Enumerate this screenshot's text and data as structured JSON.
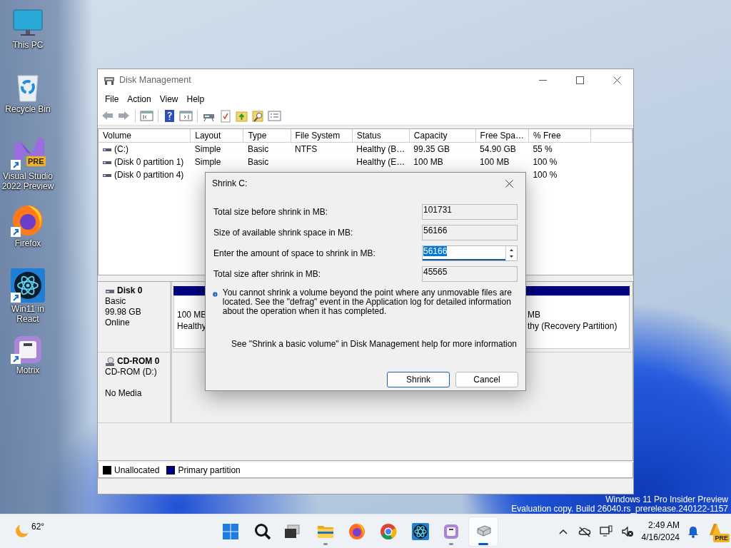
{
  "desktop_icons": [
    {
      "label": "This PC",
      "kind": "monitor",
      "shortcut": false
    },
    {
      "label": "Recycle Bin",
      "kind": "recycle",
      "shortcut": false
    },
    {
      "label": "Visual Studio 2022 Preview",
      "kind": "vs",
      "shortcut": true,
      "badge": "PRE"
    },
    {
      "label": "Firefox",
      "kind": "firefox",
      "shortcut": true
    },
    {
      "label": "Win11 in React",
      "kind": "react",
      "shortcut": true
    },
    {
      "label": "Motrix",
      "kind": "motrix",
      "shortcut": true
    }
  ],
  "window": {
    "title": "Disk Management",
    "menu": [
      "File",
      "Action",
      "View",
      "Help"
    ],
    "table": {
      "columns": [
        "Volume",
        "Layout",
        "Type",
        "File System",
        "Status",
        "Capacity",
        "Free Spa…",
        "% Free"
      ],
      "rows": [
        {
          "volume": "(C:)",
          "layout": "Simple",
          "type": "Basic",
          "file_system": "NTFS",
          "status": "Healthy (B…",
          "capacity": "99.35 GB",
          "free_space": "54.90 GB",
          "percent_free": "55 %"
        },
        {
          "volume": "(Disk 0 partition 1)",
          "layout": "Simple",
          "type": "Basic",
          "status": "Healthy (E…",
          "capacity": "100 MB",
          "free_space": "100 MB",
          "percent_free": "100 %"
        },
        {
          "volume": "(Disk 0 partition 4)",
          "percent_free": "100 %"
        }
      ]
    },
    "disks": [
      {
        "name": "Disk 0",
        "kind": "disk",
        "lines": [
          "Basic",
          "99.98 GB",
          "Online"
        ],
        "partitions": [
          {
            "lines": [
              "100 MB",
              "Healthy"
            ]
          },
          {
            "lines": [
              "MB",
              "thy (Recovery Partition)"
            ]
          }
        ]
      },
      {
        "name": "CD-ROM 0",
        "kind": "cdrom",
        "lines": [
          "CD-ROM (D:)",
          "No Media"
        ]
      }
    ],
    "legend": [
      {
        "label": "Unallocated",
        "color": "#000000"
      },
      {
        "label": "Primary partition",
        "color": "#000080"
      }
    ]
  },
  "dialog": {
    "title": "Shrink C:",
    "fields": [
      {
        "label": "Total size before shrink in MB:",
        "value": "101731",
        "kind": "readonly"
      },
      {
        "label": "Size of available shrink space in MB:",
        "value": "56166",
        "kind": "readonly"
      },
      {
        "label": "Enter the amount of space to shrink in MB:",
        "value": "56166",
        "kind": "spin",
        "text_selected": true
      },
      {
        "label": "Total size after shrink in MB:",
        "value": "45565",
        "kind": "readonly"
      }
    ],
    "info": "You cannot shrink a volume beyond the point where any unmovable files are located. See the \"defrag\" event in the Application log for detailed information about the operation when it has completed.",
    "help": "See \"Shrink a basic volume\" in Disk Management help for more information",
    "buttons": [
      {
        "label": "Shrink",
        "default": true
      },
      {
        "label": "Cancel",
        "default": false
      }
    ]
  },
  "watermark": [
    "Windows 11 Pro Insider Preview",
    "Evaluation copy. Build 26040.rs_prerelease.240122-1157"
  ],
  "taskbar": {
    "weather": "62°",
    "apps": [
      {
        "kind": "start",
        "running": false,
        "selected": false
      },
      {
        "kind": "search",
        "running": false,
        "selected": false
      },
      {
        "kind": "taskview",
        "running": false,
        "selected": false
      },
      {
        "kind": "explorer",
        "running": true,
        "selected": false
      },
      {
        "kind": "firefox",
        "running": false,
        "selected": false
      },
      {
        "kind": "chrome",
        "running": false,
        "selected": false
      },
      {
        "kind": "react",
        "running": false,
        "selected": false
      },
      {
        "kind": "motrix",
        "running": true,
        "selected": false
      },
      {
        "kind": "diskmgmt",
        "running": true,
        "selected": true
      }
    ],
    "time": "2:49 AM",
    "date": "4/16/2024",
    "tray_badge": "PRE"
  }
}
